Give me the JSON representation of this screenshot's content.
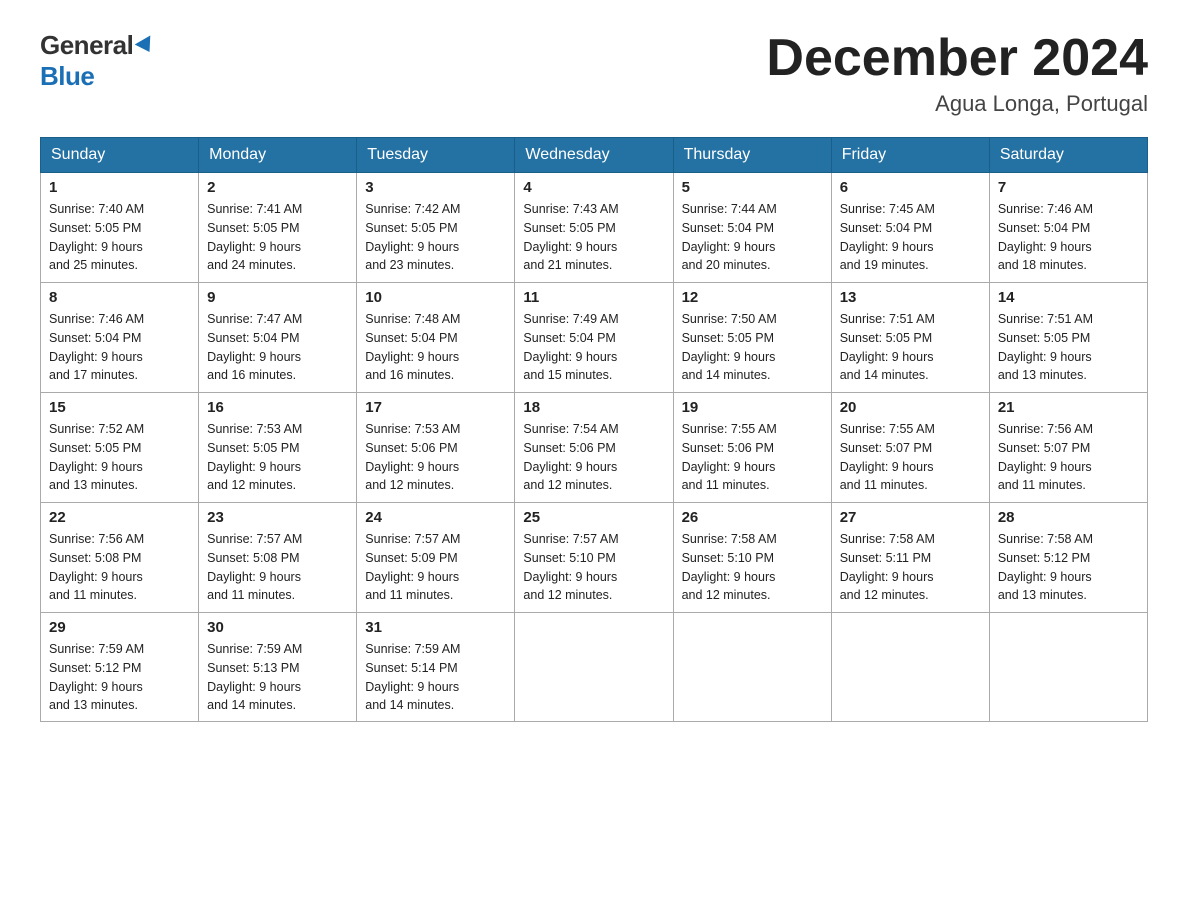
{
  "header": {
    "logo_general": "General",
    "logo_blue": "Blue",
    "month_title": "December 2024",
    "location": "Agua Longa, Portugal"
  },
  "days_of_week": [
    "Sunday",
    "Monday",
    "Tuesday",
    "Wednesday",
    "Thursday",
    "Friday",
    "Saturday"
  ],
  "weeks": [
    [
      {
        "day": "1",
        "sunrise": "7:40 AM",
        "sunset": "5:05 PM",
        "daylight": "9 hours and 25 minutes."
      },
      {
        "day": "2",
        "sunrise": "7:41 AM",
        "sunset": "5:05 PM",
        "daylight": "9 hours and 24 minutes."
      },
      {
        "day": "3",
        "sunrise": "7:42 AM",
        "sunset": "5:05 PM",
        "daylight": "9 hours and 23 minutes."
      },
      {
        "day": "4",
        "sunrise": "7:43 AM",
        "sunset": "5:05 PM",
        "daylight": "9 hours and 21 minutes."
      },
      {
        "day": "5",
        "sunrise": "7:44 AM",
        "sunset": "5:04 PM",
        "daylight": "9 hours and 20 minutes."
      },
      {
        "day": "6",
        "sunrise": "7:45 AM",
        "sunset": "5:04 PM",
        "daylight": "9 hours and 19 minutes."
      },
      {
        "day": "7",
        "sunrise": "7:46 AM",
        "sunset": "5:04 PM",
        "daylight": "9 hours and 18 minutes."
      }
    ],
    [
      {
        "day": "8",
        "sunrise": "7:46 AM",
        "sunset": "5:04 PM",
        "daylight": "9 hours and 17 minutes."
      },
      {
        "day": "9",
        "sunrise": "7:47 AM",
        "sunset": "5:04 PM",
        "daylight": "9 hours and 16 minutes."
      },
      {
        "day": "10",
        "sunrise": "7:48 AM",
        "sunset": "5:04 PM",
        "daylight": "9 hours and 16 minutes."
      },
      {
        "day": "11",
        "sunrise": "7:49 AM",
        "sunset": "5:04 PM",
        "daylight": "9 hours and 15 minutes."
      },
      {
        "day": "12",
        "sunrise": "7:50 AM",
        "sunset": "5:05 PM",
        "daylight": "9 hours and 14 minutes."
      },
      {
        "day": "13",
        "sunrise": "7:51 AM",
        "sunset": "5:05 PM",
        "daylight": "9 hours and 14 minutes."
      },
      {
        "day": "14",
        "sunrise": "7:51 AM",
        "sunset": "5:05 PM",
        "daylight": "9 hours and 13 minutes."
      }
    ],
    [
      {
        "day": "15",
        "sunrise": "7:52 AM",
        "sunset": "5:05 PM",
        "daylight": "9 hours and 13 minutes."
      },
      {
        "day": "16",
        "sunrise": "7:53 AM",
        "sunset": "5:05 PM",
        "daylight": "9 hours and 12 minutes."
      },
      {
        "day": "17",
        "sunrise": "7:53 AM",
        "sunset": "5:06 PM",
        "daylight": "9 hours and 12 minutes."
      },
      {
        "day": "18",
        "sunrise": "7:54 AM",
        "sunset": "5:06 PM",
        "daylight": "9 hours and 12 minutes."
      },
      {
        "day": "19",
        "sunrise": "7:55 AM",
        "sunset": "5:06 PM",
        "daylight": "9 hours and 11 minutes."
      },
      {
        "day": "20",
        "sunrise": "7:55 AM",
        "sunset": "5:07 PM",
        "daylight": "9 hours and 11 minutes."
      },
      {
        "day": "21",
        "sunrise": "7:56 AM",
        "sunset": "5:07 PM",
        "daylight": "9 hours and 11 minutes."
      }
    ],
    [
      {
        "day": "22",
        "sunrise": "7:56 AM",
        "sunset": "5:08 PM",
        "daylight": "9 hours and 11 minutes."
      },
      {
        "day": "23",
        "sunrise": "7:57 AM",
        "sunset": "5:08 PM",
        "daylight": "9 hours and 11 minutes."
      },
      {
        "day": "24",
        "sunrise": "7:57 AM",
        "sunset": "5:09 PM",
        "daylight": "9 hours and 11 minutes."
      },
      {
        "day": "25",
        "sunrise": "7:57 AM",
        "sunset": "5:10 PM",
        "daylight": "9 hours and 12 minutes."
      },
      {
        "day": "26",
        "sunrise": "7:58 AM",
        "sunset": "5:10 PM",
        "daylight": "9 hours and 12 minutes."
      },
      {
        "day": "27",
        "sunrise": "7:58 AM",
        "sunset": "5:11 PM",
        "daylight": "9 hours and 12 minutes."
      },
      {
        "day": "28",
        "sunrise": "7:58 AM",
        "sunset": "5:12 PM",
        "daylight": "9 hours and 13 minutes."
      }
    ],
    [
      {
        "day": "29",
        "sunrise": "7:59 AM",
        "sunset": "5:12 PM",
        "daylight": "9 hours and 13 minutes."
      },
      {
        "day": "30",
        "sunrise": "7:59 AM",
        "sunset": "5:13 PM",
        "daylight": "9 hours and 14 minutes."
      },
      {
        "day": "31",
        "sunrise": "7:59 AM",
        "sunset": "5:14 PM",
        "daylight": "9 hours and 14 minutes."
      },
      null,
      null,
      null,
      null
    ]
  ],
  "labels": {
    "sunrise_prefix": "Sunrise: ",
    "sunset_prefix": "Sunset: ",
    "daylight_prefix": "Daylight: "
  }
}
